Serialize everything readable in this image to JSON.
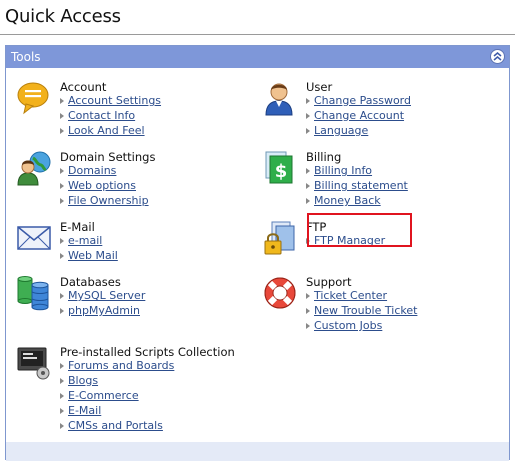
{
  "page": {
    "title": "Quick Access"
  },
  "panel": {
    "header": "Tools"
  },
  "sections": {
    "account": {
      "title": "Account",
      "icon": "speech-bubble-icon",
      "links": [
        "Account Settings",
        "Contact Info",
        "Look And Feel"
      ]
    },
    "user": {
      "title": "User",
      "icon": "user-icon",
      "links": [
        "Change Password",
        "Change Account",
        "Language"
      ]
    },
    "domain": {
      "title": "Domain Settings",
      "icon": "domain-user-globe-icon",
      "links": [
        "Domains",
        "Web options",
        "File Ownership"
      ]
    },
    "billing": {
      "title": "Billing",
      "icon": "billing-dollar-icon",
      "links": [
        "Billing Info",
        "Billing statement",
        "Money Back"
      ]
    },
    "email": {
      "title": "E-Mail",
      "icon": "envelope-icon",
      "links": [
        "e-mail",
        "Web Mail"
      ]
    },
    "ftp": {
      "title": "FTP",
      "icon": "ftp-lock-icon",
      "links": [
        "FTP Manager"
      ]
    },
    "databases": {
      "title": "Databases",
      "icon": "database-icon",
      "links": [
        "MySQL Server",
        "phpMyAdmin"
      ]
    },
    "support": {
      "title": "Support",
      "icon": "lifebuoy-icon",
      "links": [
        "Ticket Center",
        "New Trouble Ticket",
        "Custom Jobs"
      ]
    },
    "scripts": {
      "title": "Pre-installed Scripts Collection",
      "icon": "scripts-monitor-icon",
      "links": [
        "Forums and Boards",
        "Blogs",
        "E-Commerce",
        "E-Mail",
        "CMSs and Portals"
      ]
    }
  },
  "colors": {
    "header": "#7e97d9",
    "link": "#2c4d8c",
    "highlight": "#e0141f"
  }
}
